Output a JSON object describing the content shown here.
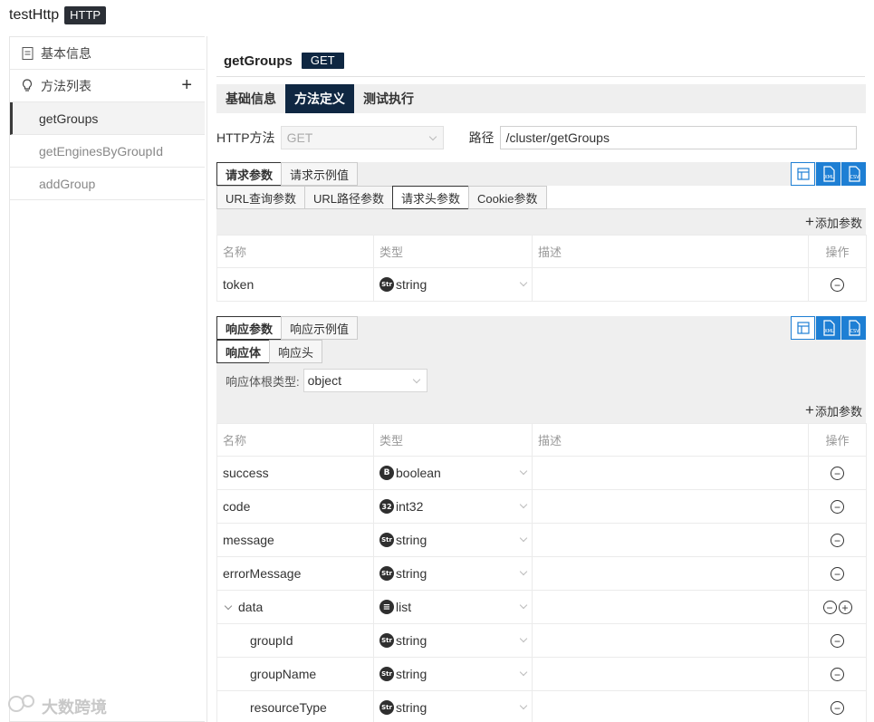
{
  "app": {
    "title": "testHttp",
    "badge": "HTTP"
  },
  "sidebar": {
    "basic_info": "基本信息",
    "method_list": "方法列表",
    "methods": [
      {
        "label": "getGroups",
        "active": true
      },
      {
        "label": "getEnginesByGroupId",
        "active": false
      },
      {
        "label": "addGroup",
        "active": false
      }
    ]
  },
  "method": {
    "name": "getGroups",
    "verb": "GET"
  },
  "tabs": [
    "基础信息",
    "方法定义",
    "测试执行"
  ],
  "http": {
    "method_label": "HTTP方法",
    "method_value": "GET",
    "path_label": "路径",
    "path_value": "/cluster/getGroups"
  },
  "request": {
    "tabs": [
      "请求参数",
      "请求示例值"
    ],
    "subtabs": [
      "URL查询参数",
      "URL路径参数",
      "请求头参数",
      "Cookie参数"
    ],
    "add_label": "添加参数",
    "columns": [
      "名称",
      "类型",
      "描述",
      "操作"
    ],
    "rows": [
      {
        "name": "token",
        "icon": "Str",
        "type": "string",
        "desc": ""
      }
    ]
  },
  "response": {
    "tabs": [
      "响应参数",
      "响应示例值"
    ],
    "subtabs": [
      "响应体",
      "响应头"
    ],
    "root_label": "响应体根类型:",
    "root_value": "object",
    "add_label": "添加参数",
    "columns": [
      "名称",
      "类型",
      "描述",
      "操作"
    ],
    "rows": [
      {
        "name": "success",
        "icon": "B",
        "type": "boolean"
      },
      {
        "name": "code",
        "icon": "32",
        "type": "int32"
      },
      {
        "name": "message",
        "icon": "Str",
        "type": "string"
      },
      {
        "name": "errorMessage",
        "icon": "Str",
        "type": "string"
      },
      {
        "name": "data",
        "icon": "≡",
        "type": "list"
      },
      {
        "name": "groupId",
        "icon": "Str",
        "type": "string"
      },
      {
        "name": "groupName",
        "icon": "Str",
        "type": "string"
      },
      {
        "name": "resourceType",
        "icon": "Str",
        "type": "string"
      }
    ]
  },
  "tools": [
    "table-view-icon",
    "xml-icon",
    "csv-icon"
  ],
  "watermark": "大数跨境",
  "colors": {
    "nav_dark": "#0f2742",
    "tool_blue": "#1e7fd4"
  }
}
